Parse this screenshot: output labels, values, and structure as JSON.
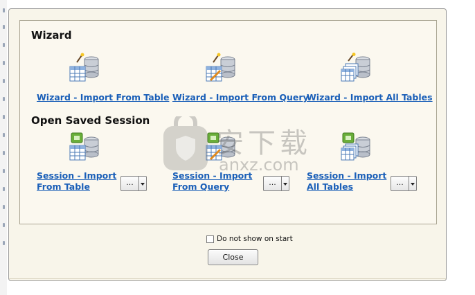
{
  "wizard": {
    "title": "Wizard",
    "links": [
      {
        "label": "Wizard - Import From Table",
        "icon": "db-table-wand-icon"
      },
      {
        "label": "Wizard - Import From Query",
        "icon": "db-query-wand-icon"
      },
      {
        "label": "Wizard - Import All Tables",
        "icon": "db-all-tables-wand-icon"
      }
    ]
  },
  "sessions": {
    "title": "Open Saved Session",
    "items": [
      {
        "label": "Session - Import From Table",
        "icon": "session-table-icon",
        "button": "..."
      },
      {
        "label": "Session - Import From Query",
        "icon": "session-query-icon",
        "button": "..."
      },
      {
        "label": "Session - Import All Tables",
        "icon": "session-all-tables-icon",
        "button": "..."
      }
    ]
  },
  "footer": {
    "checkbox_label": "Do not show on start",
    "checkbox_checked": false,
    "close_label": "Close"
  },
  "watermark": {
    "text_cn": "安下载",
    "text_url": "anxz.com"
  }
}
